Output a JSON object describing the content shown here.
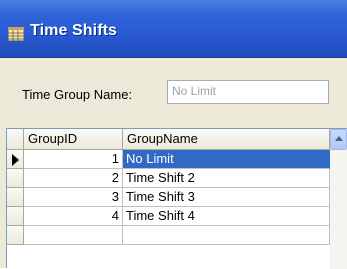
{
  "window": {
    "title": "Time Shifts"
  },
  "form": {
    "time_group_name_label": "Time Group Name:",
    "time_group_name_value": "No Limit"
  },
  "grid": {
    "columns": [
      "GroupID",
      "GroupName"
    ],
    "rows": [
      {
        "id": "1",
        "name": "No Limit",
        "selected": true
      },
      {
        "id": "2",
        "name": "Time Shift 2",
        "selected": false
      },
      {
        "id": "3",
        "name": "Time Shift 3",
        "selected": false
      },
      {
        "id": "4",
        "name": "Time Shift 4",
        "selected": false
      }
    ]
  },
  "colors": {
    "titlebar": "#2757cf",
    "selection": "#316ac5",
    "form_background": "#ece9d8"
  },
  "icons": {
    "title": "table-grid-icon",
    "row_pointer": "current-row-pointer-icon",
    "scroll_up": "chevron-up-icon"
  }
}
